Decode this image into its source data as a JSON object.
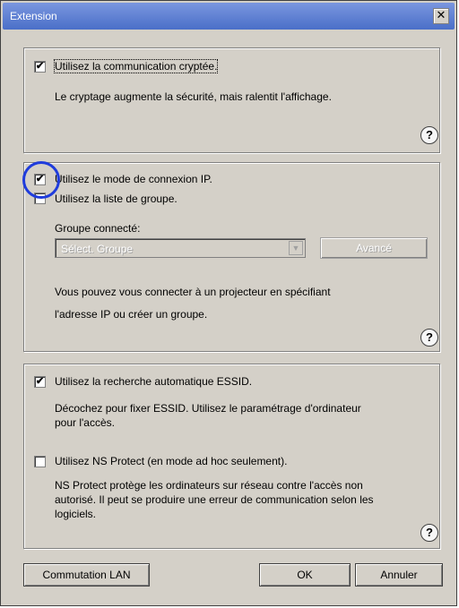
{
  "window": {
    "title": "Extension"
  },
  "encryption": {
    "checkbox_label": "Utilisez la communication cryptée.",
    "checked": true,
    "description": "Le cryptage augmente la sécurité, mais ralentit l'affichage."
  },
  "ip_mode": {
    "checkbox_label": "Utilisez le mode de connexion IP.",
    "checked": true,
    "group_list_label": "Utilisez la liste de groupe.",
    "group_list_checked": false,
    "connected_group_label": "Groupe connecté:",
    "select_value": "Sélect. Groupe",
    "advanced_button": "Avancé",
    "description_line1": "Vous pouvez vous connecter à un projecteur en spécifiant",
    "description_line2": "l'adresse IP ou créer un groupe."
  },
  "essid": {
    "checkbox_label": "Utilisez la recherche automatique ESSID.",
    "checked": true,
    "description_line1": "Décochez pour fixer ESSID. Utilisez le paramétrage d'ordinateur",
    "description_line2": "pour l'accès.",
    "ns_label": "Utilisez NS Protect (en mode ad hoc seulement).",
    "ns_checked": false,
    "ns_description_line1": "NS Protect protège les ordinateurs sur réseau contre l'accès non",
    "ns_description_line2": "autorisé. Il peut se produire une erreur de communication selon les",
    "ns_description_line3": "logiciels."
  },
  "footer": {
    "lan_button": "Commutation LAN",
    "ok_button": "OK",
    "cancel_button": "Annuler"
  },
  "icons": {
    "help": "?",
    "close": "✕",
    "check": "✔",
    "dropdown": "▼"
  }
}
